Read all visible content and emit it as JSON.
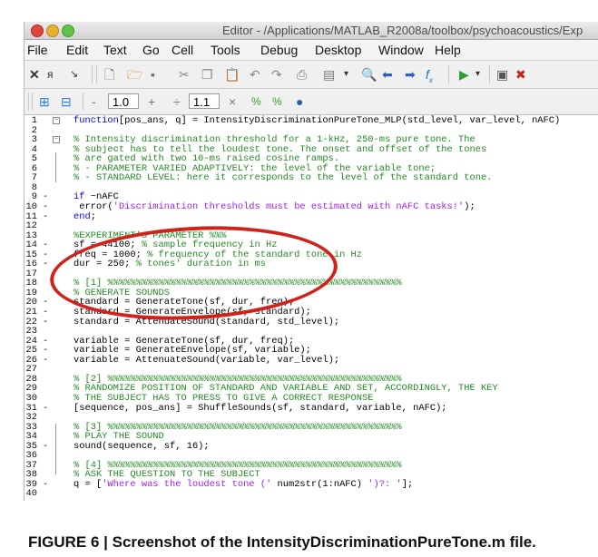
{
  "window": {
    "title": "Editor - /Applications/MATLAB_R2008a/toolbox/psychoacoustics/Exp",
    "traffic_lights": [
      "close",
      "minimize",
      "zoom"
    ]
  },
  "menu": [
    "File",
    "Edit",
    "Text",
    "Go",
    "Cell",
    "Tools",
    "Debug",
    "Desktop",
    "Window",
    "Help"
  ],
  "toolbar1_icons": [
    "cut-small-icon",
    "bracket-icon",
    "indent-icon",
    "new-file-icon",
    "open-folder-icon",
    "save-icon",
    "cut-icon",
    "copy-icon",
    "paste-icon",
    "undo-icon",
    "redo-icon",
    "print-icon",
    "comment-icon",
    "dropdown-arrow-icon",
    "find-icon",
    "back-arrow-icon",
    "forward-arrow-icon",
    "function-icon",
    "run-icon",
    "dropdown-arrow-icon",
    "breakpoint-icon",
    "clear-breakpoint-icon"
  ],
  "toolbar2": {
    "minus_label": "-",
    "value1": "1.0",
    "plus_label": "+",
    "divide_label": "÷",
    "value2": "1.1",
    "times_label": "×"
  },
  "code_lines": [
    {
      "n": "1",
      "d": "",
      "p": [
        [
          "kw",
          "function"
        ],
        [
          "",
          "[pos_ans, q] = IntensityDiscriminationPureTone_MLP(std_level, var_level, nAFC)"
        ]
      ]
    },
    {
      "n": "2",
      "d": "",
      "p": [
        [
          "",
          ""
        ]
      ]
    },
    {
      "n": "3",
      "d": "",
      "p": [
        [
          "cm",
          "% Intensity discrimination threshold for a 1-kHz, 250-ms pure tone. The"
        ]
      ]
    },
    {
      "n": "4",
      "d": "",
      "p": [
        [
          "cm",
          "% subject has to tell the loudest tone. The onset and offset of the tones"
        ]
      ]
    },
    {
      "n": "5",
      "d": "",
      "p": [
        [
          "cm",
          "% are gated with two 10-ms raised cosine ramps."
        ]
      ]
    },
    {
      "n": "6",
      "d": "",
      "p": [
        [
          "cm",
          "% - PARAMETER VARIED ADAPTIVELY: the level of the variable tone;"
        ]
      ]
    },
    {
      "n": "7",
      "d": "",
      "p": [
        [
          "cm",
          "% - STANDARD LEVEL: here it corresponds to the level of the standard tone."
        ]
      ]
    },
    {
      "n": "8",
      "d": "",
      "p": [
        [
          "",
          ""
        ]
      ]
    },
    {
      "n": "9",
      "d": "-",
      "p": [
        [
          "kw",
          "if"
        ],
        [
          "",
          " ~nAFC"
        ]
      ]
    },
    {
      "n": "10",
      "d": "-",
      "p": [
        [
          "",
          " error("
        ],
        [
          "str",
          "'Discrimination thresholds must be estimated with nAFC tasks!'"
        ],
        [
          "",
          ");"
        ]
      ]
    },
    {
      "n": "11",
      "d": "-",
      "p": [
        [
          "kw",
          "end"
        ],
        [
          "",
          ";"
        ]
      ]
    },
    {
      "n": "12",
      "d": "",
      "p": [
        [
          "",
          ""
        ]
      ]
    },
    {
      "n": "13",
      "d": "",
      "p": [
        [
          "cm",
          "%EXPERIMENT'S PARAMETER %%%"
        ]
      ]
    },
    {
      "n": "14",
      "d": "-",
      "p": [
        [
          "",
          "sf = 44100; "
        ],
        [
          "cm",
          "% sample frequency in Hz"
        ]
      ]
    },
    {
      "n": "15",
      "d": "-",
      "p": [
        [
          "",
          "freq = 1000; "
        ],
        [
          "cm",
          "% frequency of the standard tone in Hz"
        ]
      ]
    },
    {
      "n": "16",
      "d": "-",
      "p": [
        [
          "",
          "dur = 250; "
        ],
        [
          "cm",
          "% tones' duration in ms"
        ]
      ]
    },
    {
      "n": "17",
      "d": "",
      "p": [
        [
          "",
          ""
        ]
      ]
    },
    {
      "n": "18",
      "d": "",
      "p": [
        [
          "cm",
          "% [1] %%%%%%%%%%%%%%%%%%%%%%%%%%%%%%%%%%%%%%%%%%%%%%%%%%%%"
        ]
      ]
    },
    {
      "n": "19",
      "d": "",
      "p": [
        [
          "cm",
          "% GENERATE SOUNDS"
        ]
      ]
    },
    {
      "n": "20",
      "d": "-",
      "p": [
        [
          "",
          "standard = GenerateTone(sf, dur, freq);"
        ]
      ]
    },
    {
      "n": "21",
      "d": "-",
      "p": [
        [
          "",
          "standard = GenerateEnvelope(sf, standard);"
        ]
      ]
    },
    {
      "n": "22",
      "d": "-",
      "p": [
        [
          "",
          "standard = AttenuateSound(standard, std_level);"
        ]
      ]
    },
    {
      "n": "23",
      "d": "",
      "p": [
        [
          "",
          ""
        ]
      ]
    },
    {
      "n": "24",
      "d": "-",
      "p": [
        [
          "",
          "variable = GenerateTone(sf, dur, freq);"
        ]
      ]
    },
    {
      "n": "25",
      "d": "-",
      "p": [
        [
          "",
          "variable = GenerateEnvelope(sf, variable);"
        ]
      ]
    },
    {
      "n": "26",
      "d": "-",
      "p": [
        [
          "",
          "variable = AttenuateSound(variable, var_level);"
        ]
      ]
    },
    {
      "n": "27",
      "d": "",
      "p": [
        [
          "",
          ""
        ]
      ]
    },
    {
      "n": "28",
      "d": "",
      "p": [
        [
          "cm",
          "% [2] %%%%%%%%%%%%%%%%%%%%%%%%%%%%%%%%%%%%%%%%%%%%%%%%%%%%"
        ]
      ]
    },
    {
      "n": "29",
      "d": "",
      "p": [
        [
          "cm",
          "% RANDOMIZE POSITION OF STANDARD AND VARIABLE AND SET, ACCORDINGLY, THE KEY"
        ]
      ]
    },
    {
      "n": "30",
      "d": "",
      "p": [
        [
          "cm",
          "% THE SUBJECT HAS TO PRESS TO GIVE A CORRECT RESPONSE"
        ]
      ]
    },
    {
      "n": "31",
      "d": "-",
      "p": [
        [
          "",
          "[sequence, pos_ans] = ShuffleSounds(sf, standard, variable, nAFC);"
        ]
      ]
    },
    {
      "n": "32",
      "d": "",
      "p": [
        [
          "",
          ""
        ]
      ]
    },
    {
      "n": "33",
      "d": "",
      "p": [
        [
          "cm",
          "% [3] %%%%%%%%%%%%%%%%%%%%%%%%%%%%%%%%%%%%%%%%%%%%%%%%%%%%"
        ]
      ]
    },
    {
      "n": "34",
      "d": "",
      "p": [
        [
          "cm",
          "% PLAY THE SOUND"
        ]
      ]
    },
    {
      "n": "35",
      "d": "-",
      "p": [
        [
          "",
          "sound(sequence, sf, 16);"
        ]
      ]
    },
    {
      "n": "36",
      "d": "",
      "p": [
        [
          "",
          ""
        ]
      ]
    },
    {
      "n": "37",
      "d": "",
      "p": [
        [
          "cm",
          "% [4] %%%%%%%%%%%%%%%%%%%%%%%%%%%%%%%%%%%%%%%%%%%%%%%%%%%%"
        ]
      ]
    },
    {
      "n": "38",
      "d": "",
      "p": [
        [
          "cm",
          "% ASK THE QUESTION TO THE SUBJECT"
        ]
      ]
    },
    {
      "n": "39",
      "d": "-",
      "p": [
        [
          "",
          "q = ["
        ],
        [
          "str",
          "'Where was the loudest tone ('"
        ],
        [
          "",
          " num2str(1:nAFC) "
        ],
        [
          "str",
          "')?: '"
        ],
        [
          "",
          "];"
        ]
      ]
    },
    {
      "n": "40",
      "d": "",
      "p": [
        [
          "",
          ""
        ]
      ]
    }
  ],
  "caption": "FIGURE 6 | Screenshot of the IntensityDiscriminationPureTone.m file.",
  "colors": {
    "keyword": "#0000ff",
    "comment": "#228b22",
    "string": "#a020f0",
    "highlight_oval": "#d0211b"
  }
}
